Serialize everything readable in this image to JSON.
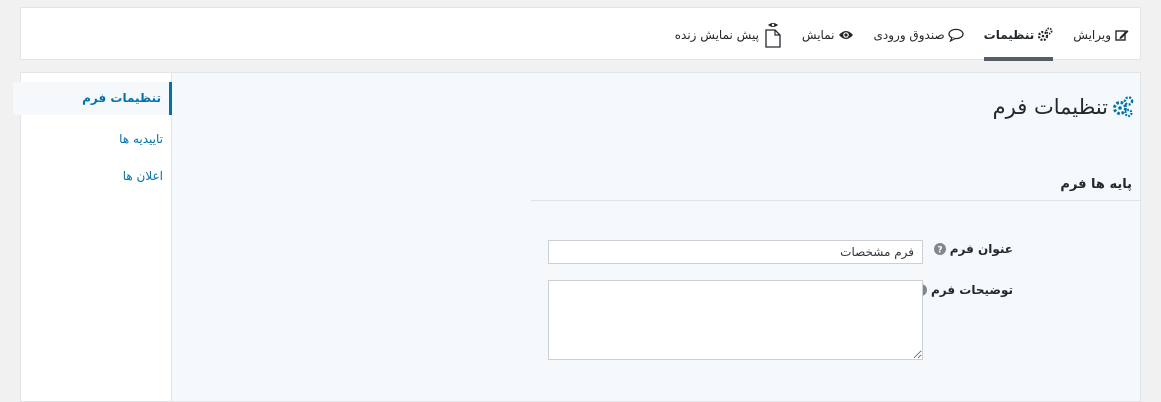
{
  "tabs": [
    {
      "label": "ویرایش",
      "icon": "edit-icon"
    },
    {
      "label": "تنظیمات",
      "icon": "gears-icon",
      "active": true
    },
    {
      "label": "صندوق ورودی",
      "icon": "comment-icon"
    },
    {
      "label": "نمایش",
      "icon": "eye-icon"
    },
    {
      "label": "پیش نمایش زنده",
      "icon": "document-eye-icon"
    }
  ],
  "sidebar": {
    "items": [
      {
        "label": "تنظیمات فرم",
        "active": true
      },
      {
        "label": "تاییدیه ها"
      },
      {
        "label": "اعلان ها"
      }
    ]
  },
  "main": {
    "title": "تنظیمات فرم",
    "title_icon": "gears-icon",
    "section_title": "پایه ها فرم",
    "fields": [
      {
        "label": "عنوان فرم",
        "value": "فرم مشخصات",
        "help_icon": "help-icon"
      },
      {
        "label": "توضیحات فرم",
        "value": "",
        "help_icon": "help-icon"
      }
    ]
  },
  "colors": {
    "accent": "#0073aa",
    "background": "#f1f1f1",
    "panel": "#f5f9fc",
    "active_tab_underline": "#555d66"
  }
}
